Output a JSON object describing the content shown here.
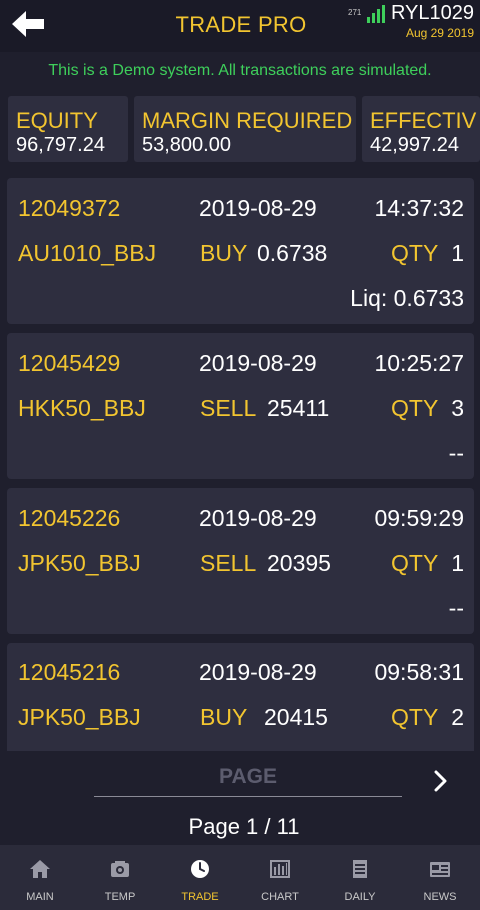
{
  "header": {
    "title": "TRADE PRO",
    "signal_count": "271",
    "account_id": "RYL1029",
    "date": "Aug 29 2019"
  },
  "notice": "This is a Demo system. All transactions are simulated.",
  "summary": [
    {
      "label": "EQUITY",
      "value": "96,797.24"
    },
    {
      "label": "MARGIN REQUIRED",
      "value": "53,800.00"
    },
    {
      "label": "EFFECTIV",
      "value": "42,997.24"
    }
  ],
  "trades": [
    {
      "id": "12049372",
      "date": "2019-08-29",
      "time": "14:37:32",
      "symbol": "AU1010_BBJ",
      "side": "BUY",
      "price": "0.6738",
      "qty_label": "QTY",
      "qty": "1",
      "liq": "Liq: 0.6733"
    },
    {
      "id": "12045429",
      "date": "2019-08-29",
      "time": "10:25:27",
      "symbol": "HKK50_BBJ",
      "side": "SELL",
      "price": "25411",
      "qty_label": "QTY",
      "qty": "3",
      "liq": "--"
    },
    {
      "id": "12045226",
      "date": "2019-08-29",
      "time": "09:59:29",
      "symbol": "JPK50_BBJ",
      "side": "SELL",
      "price": "20395",
      "qty_label": "QTY",
      "qty": "1",
      "liq": "--"
    },
    {
      "id": "12045216",
      "date": "2019-08-29",
      "time": "09:58:31",
      "symbol": "JPK50_BBJ",
      "side": "BUY",
      "price": "20415",
      "qty_label": "QTY",
      "qty": "2",
      "liq": ""
    }
  ],
  "pagination": {
    "label": "PAGE",
    "counter": "Page 1 / 11"
  },
  "nav": {
    "items": [
      {
        "label": "MAIN",
        "icon": "home-icon"
      },
      {
        "label": "TEMP",
        "icon": "temp-icon"
      },
      {
        "label": "TRADE",
        "icon": "clock-icon"
      },
      {
        "label": "CHART",
        "icon": "chart-icon"
      },
      {
        "label": "DAILY",
        "icon": "document-icon"
      },
      {
        "label": "NEWS",
        "icon": "news-icon"
      }
    ],
    "active": "TRADE"
  },
  "colors": {
    "accent": "#f2c530",
    "notice": "#3ecf5b",
    "background": "#1f1f2d",
    "card": "#2e2e3f"
  }
}
